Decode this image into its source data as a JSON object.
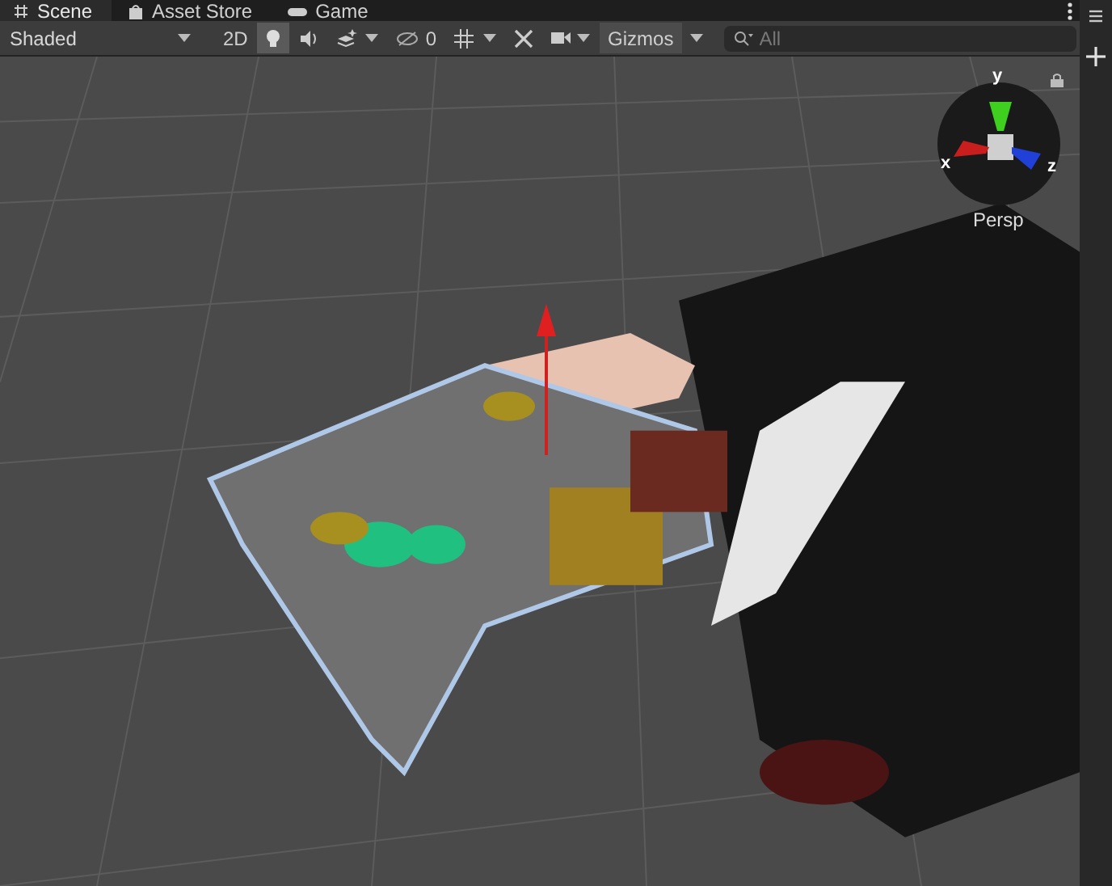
{
  "tabs": [
    {
      "label": "Scene",
      "selected": true
    },
    {
      "label": "Asset Store",
      "selected": false
    },
    {
      "label": "Game",
      "selected": false
    }
  ],
  "toolbar": {
    "draw_mode": "Shaded",
    "items": [
      {
        "kind": "text-toggle",
        "label": "2D",
        "on": false
      },
      {
        "kind": "lighting-toggle",
        "on": true
      },
      {
        "kind": "audio-toggle",
        "on": false
      },
      {
        "kind": "effects-toggle",
        "on": false
      },
      {
        "kind": "hidden-count",
        "label": "0"
      },
      {
        "kind": "grid-toggle",
        "on": false
      },
      {
        "kind": "tools-toggle",
        "on": false
      },
      {
        "kind": "camera-toggle",
        "on": false
      },
      {
        "kind": "gizmos",
        "label": "Gizmos",
        "on": false
      }
    ],
    "search": {
      "placeholder": "All"
    }
  },
  "orientation_gizmo": {
    "axes": [
      {
        "label": "y",
        "color": "#3fcf1f"
      },
      {
        "label": "x",
        "color": "#c81e1e"
      },
      {
        "label": "z",
        "color": "#2040d8"
      }
    ],
    "projection": "Persp"
  }
}
